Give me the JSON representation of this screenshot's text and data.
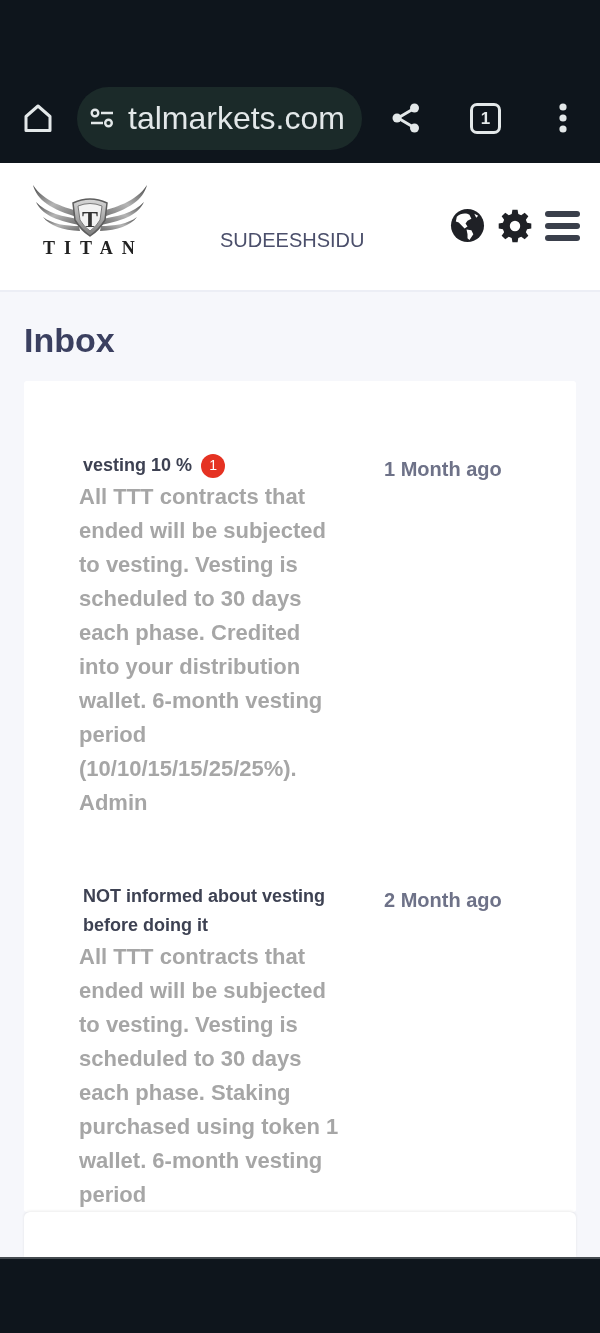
{
  "browser": {
    "url": "talmarkets.com",
    "tab_count": "1"
  },
  "header": {
    "logo": {
      "emblem_letter": "T",
      "wordmark": "TITAN"
    },
    "username": "SUDEESHSIDU"
  },
  "page": {
    "title": "Inbox"
  },
  "messages": [
    {
      "title": "vesting 10 %",
      "badge": "1",
      "body": "All TTT contracts that ended will be subjected to vesting. Vesting is scheduled to 30 days each phase. Credited into your distribution wallet. 6-month vesting period (10/10/15/15/25/25%). Admin",
      "time": "1 Month ago"
    },
    {
      "title": "NOT informed about vesting before doing it",
      "body": "All TTT contracts that ended will be subjected to vesting. Vesting is scheduled to 30 days each phase. Staking purchased using token 1 wallet. 6-month vesting period",
      "time": "2 Month ago"
    }
  ]
}
